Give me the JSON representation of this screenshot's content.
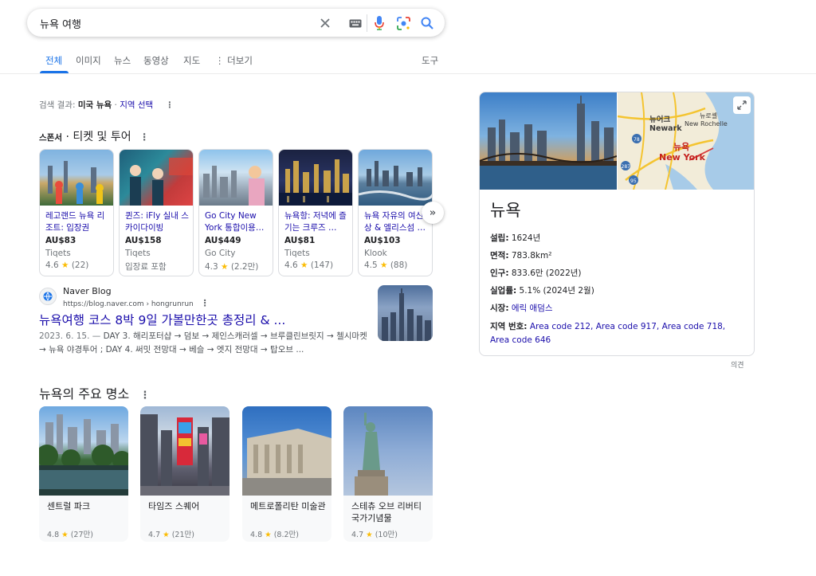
{
  "search": {
    "query": "뉴욕 여행"
  },
  "tabs": [
    {
      "label": "전체"
    },
    {
      "label": "이미지"
    },
    {
      "label": "뉴스"
    },
    {
      "label": "동영상"
    },
    {
      "label": "지도"
    },
    {
      "label": "더보기"
    }
  ],
  "tools_label": "도구",
  "meta": {
    "prefix": "검색 결과:",
    "location": "미국 뉴욕",
    "sep": "·",
    "link": "지역 선택"
  },
  "sponsor": {
    "label": "스폰서",
    "title": "· 티켓 및 투어"
  },
  "products": [
    {
      "title": "레고랜드 뉴욕 리조트: 입장권",
      "price": "AU$83",
      "seller": "Tiqets",
      "rating": "4.6",
      "reviews": "(22)"
    },
    {
      "title": "퀸즈: iFly 실내 스카이다이빙",
      "price": "AU$158",
      "seller": "Tiqets",
      "extra": "입장료 포함"
    },
    {
      "title": "Go City New York 통합이용…",
      "price": "AU$449",
      "seller": "Go City",
      "rating": "4.3",
      "reviews": "(2.2만)"
    },
    {
      "title": "뉴욕항: 저녁에 즐기는 크루즈 …",
      "price": "AU$81",
      "seller": "Tiqets",
      "rating": "4.6",
      "reviews": "(147)"
    },
    {
      "title": "뉴욕 자유의 여신상 & 엘리스섬 …",
      "price": "AU$103",
      "seller": "Klook",
      "rating": "4.5",
      "reviews": "(88)"
    }
  ],
  "result": {
    "site": "Naver Blog",
    "url": "https://blog.naver.com › hongrunrun",
    "title": "뉴욕여행 코스 8박 9일 가볼만한곳 총정리 & ...",
    "date": "2023. 6. 15. — ",
    "snippet": "DAY 3. 해리포터샵 → 덤보 → 제인스캐러셀 → 브루클린브릿지 → 첼시마켓 → 뉴욕 야경투어 ; DAY 4. 써밋 전망대 → 베슬 → 엣지 전망대 → 탑오브 ..."
  },
  "attractions": {
    "title": "뉴욕의 주요 명소",
    "items": [
      {
        "name": "센트럴 파크",
        "rating": "4.8",
        "reviews": "(27만)"
      },
      {
        "name": "타임즈 스퀘어",
        "rating": "4.7",
        "reviews": "(21만)"
      },
      {
        "name": "메트로폴리탄 미술관",
        "rating": "4.8",
        "reviews": "(8.2만)"
      },
      {
        "name": "스테츄 오브 리버티 국가기념물",
        "rating": "4.7",
        "reviews": "(10만)"
      }
    ]
  },
  "knowledge": {
    "title": "뉴욕",
    "map_labels": {
      "manhattan": "뉴어크",
      "newark": "Newark",
      "nr_ko": "뉴로셸",
      "new_rochelle": "New Rochelle",
      "ny_ko": "뉴욕",
      "new_york": "New York",
      "road_1": "287",
      "road_2": "95",
      "road_3": "78"
    },
    "rows": [
      {
        "key": "설립:",
        "value": "1624년"
      },
      {
        "key": "면적:",
        "value": "783.8km²"
      },
      {
        "key": "인구:",
        "value": "833.6만 (2022년)"
      },
      {
        "key": "실업률:",
        "value": "5.1% (2024년 2월)"
      },
      {
        "key": "시장:",
        "value": "에릭 애덤스",
        "link": true
      },
      {
        "key": "지역 번호:",
        "value": "Area code 212, Area code 917, Area code 718, Area code 646",
        "link": true
      }
    ]
  },
  "feedback": "의견",
  "colors": {
    "link": "#1a0dab",
    "accent": "#1a73e8",
    "star": "#fbbc04"
  }
}
